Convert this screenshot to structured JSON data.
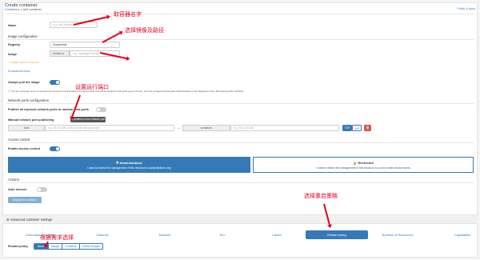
{
  "page": {
    "title": "Create container",
    "breadcrumb_root": "Containers",
    "breadcrumb_current": "Add container",
    "help_link": "Help & docs"
  },
  "form": {
    "name_label": "Name",
    "name_placeholder": "e.g. myContainer",
    "image_section": "Image configuration",
    "registry_label": "Registry",
    "registry_value": "DockerHub",
    "image_label": "Image",
    "image_prefix": "docker.io",
    "image_placeholder": "e.g. myImage:myTag",
    "image_field_required": "Image name is required.",
    "advanced_mode": "Advanced mode",
    "always_pull_label": "Always pull the image",
    "rate_limit_note": "You are currently using an anonymous account to pull images from DockerHub and will be limited to 100 pulls every 6 hours. You can configure DockerHub authentication in the Registries View. Remaining pulls: 100/100",
    "ports_section": "Network ports configuration",
    "publish_all_label": "Publish all exposed network ports to random host ports",
    "manual_publish_label": "Manual network port publishing",
    "publish_button": "publish a new network port",
    "host_label": "host",
    "host_placeholder": "e.g. 80, 80-88, ip:80 or ip:80-88 (optional)",
    "container_label": "container",
    "container_placeholder": "e.g. 80 or 80-88",
    "tcp": "TCP",
    "udp": "UDP",
    "access_section": "Access control",
    "enable_access_label": "Enable access control",
    "admins_title": "Administrators",
    "admins_desc": "I want to restrict the management of this resource to administrators only",
    "restricted_title": "Restricted",
    "restricted_desc": "I want to restrict the management of this resource to a set of users and/or teams",
    "actions_section": "Actions",
    "auto_remove_label": "Auto remove",
    "deploy_button": "Deploy the container",
    "advanced_settings": "Advanced container settings",
    "restart_policy_label": "Restart policy"
  },
  "tabs": [
    "Command & logging",
    "Volumes",
    "Network",
    "Env",
    "Labels",
    "Restart policy",
    "Runtime & Resources",
    "Capabilities"
  ],
  "restart_options": [
    "Never",
    "Always",
    "On failure",
    "Unless stopped"
  ],
  "annotations": {
    "name": "取容器名字",
    "image": "选择镜像及路径",
    "ports": "设置运行端口",
    "restart": "选择重启策略",
    "choose": "根据需求选择"
  },
  "colors": {
    "primary": "#337ab7",
    "danger": "#d9534f",
    "annotation": "#e4001f"
  }
}
